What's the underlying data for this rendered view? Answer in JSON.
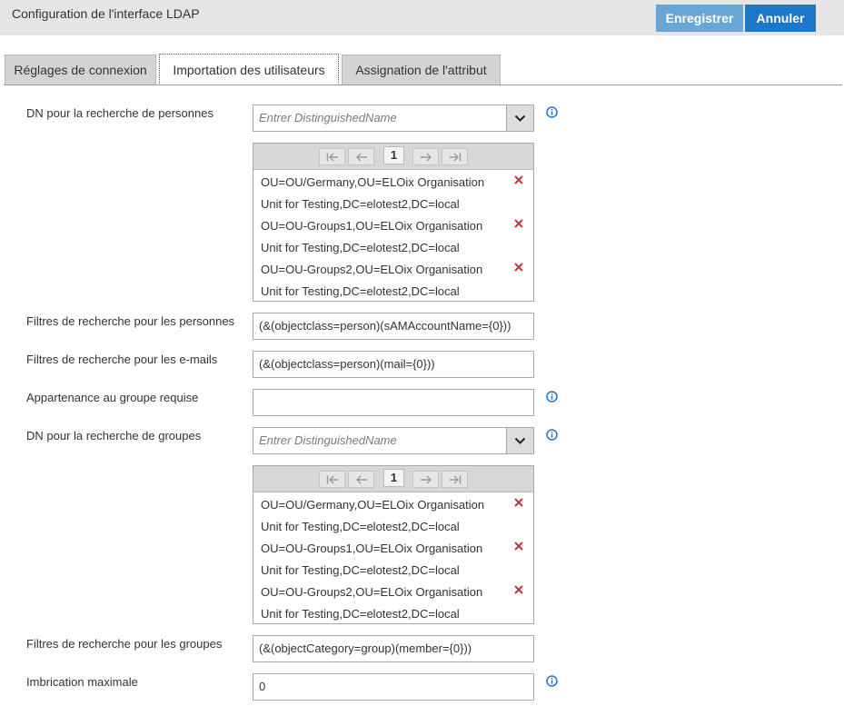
{
  "header": {
    "title": "Configuration de l'interface LDAP",
    "save_label": "Enregistrer",
    "cancel_label": "Annuler"
  },
  "tabs": [
    {
      "label": "Réglages de connexion",
      "active": false
    },
    {
      "label": "Importation des utilisateurs",
      "active": true
    },
    {
      "label": "Assignation de l'attribut",
      "active": false
    }
  ],
  "form": {
    "person_dn": {
      "label": "DN pour la recherche de personnes",
      "placeholder": "Entrer DistinguishedName",
      "page": "1",
      "entries": [
        "OU=OU/Germany,OU=ELOix Organisation Unit for Testing,DC=elotest2,DC=local",
        "OU=OU-Groups1,OU=ELOix Organisation Unit for Testing,DC=elotest2,DC=local",
        "OU=OU-Groups2,OU=ELOix Organisation Unit for Testing,DC=elotest2,DC=local"
      ]
    },
    "person_filter": {
      "label": "Filtres de recherche pour les personnes",
      "value": "(&(objectclass=person)(sAMAccountName={0}))"
    },
    "email_filter": {
      "label": "Filtres de recherche pour les e-mails",
      "value": "(&(objectclass=person)(mail={0}))"
    },
    "group_membership": {
      "label": "Appartenance au groupe requise",
      "value": ""
    },
    "group_dn": {
      "label": "DN pour la recherche de groupes",
      "placeholder": "Entrer DistinguishedName",
      "page": "1",
      "entries": [
        "OU=OU/Germany,OU=ELOix Organisation Unit for Testing,DC=elotest2,DC=local",
        "OU=OU-Groups1,OU=ELOix Organisation Unit for Testing,DC=elotest2,DC=local",
        "OU=OU-Groups2,OU=ELOix Organisation Unit for Testing,DC=elotest2,DC=local"
      ]
    },
    "group_filter": {
      "label": "Filtres de recherche pour les groupes",
      "value": "(&(objectCategory=group)(member={0}))"
    },
    "max_nesting": {
      "label": "Imbrication maximale",
      "value": "0"
    }
  },
  "icons": {
    "info": "info-icon",
    "delete": "close-icon",
    "dropdown": "chevron-down-icon",
    "first_page": "first-page-icon",
    "prev_page": "arrow-left-icon",
    "next_page": "arrow-right-icon",
    "last_page": "last-page-icon"
  },
  "colors": {
    "save_button": "#6aa5d8",
    "cancel_button": "#1d77c9",
    "info_icon": "#1d77c9",
    "delete_icon": "#c8334a",
    "header_bg": "#e5e5e5"
  }
}
